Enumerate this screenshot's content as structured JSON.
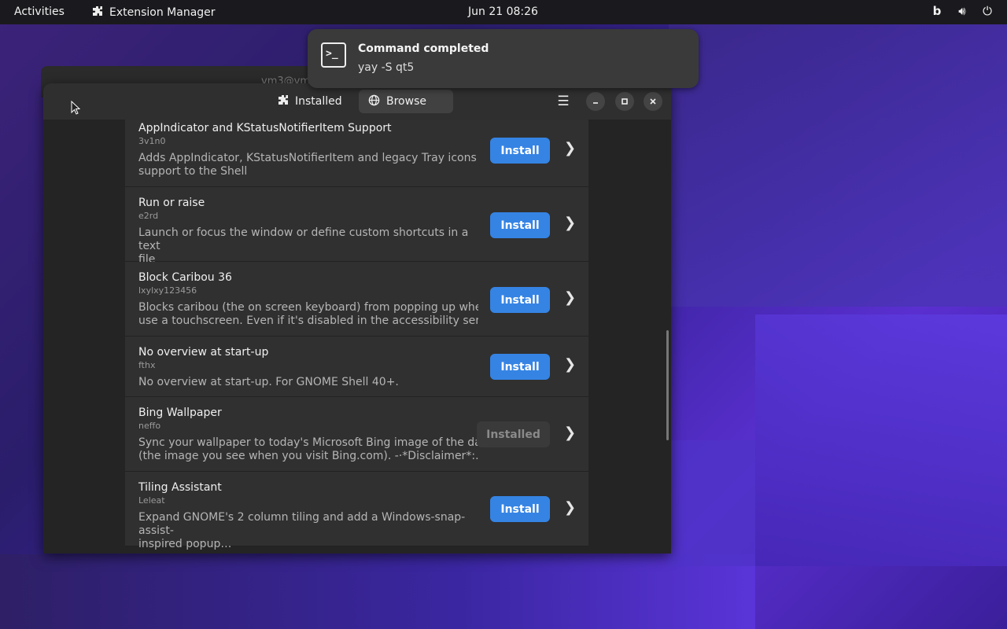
{
  "topbar": {
    "activities": "Activities",
    "app_name": "Extension Manager",
    "clock": "Jun 21  08:26",
    "icons": [
      "bing-icon",
      "volume-icon",
      "power-icon"
    ]
  },
  "background_window": {
    "title_partial": "vm3@vm"
  },
  "notification": {
    "title": "Command completed",
    "body": "yay -S qt5",
    "icon": "terminal-icon"
  },
  "window": {
    "tabs": [
      {
        "label": "Installed",
        "icon": "puzzle-icon",
        "active": false
      },
      {
        "label": "Browse",
        "icon": "globe-icon",
        "active": true
      }
    ],
    "controls": [
      "menu",
      "minimize",
      "maximize",
      "close"
    ]
  },
  "extensions": [
    {
      "name": "AppIndicator and KStatusNotifierItem Support",
      "author": "3v1n0",
      "desc1": "Adds AppIndicator, KStatusNotifierItem and legacy Tray icons",
      "desc2": "support to the Shell",
      "action": "Install"
    },
    {
      "name": "Run or raise",
      "author": "e2rd",
      "desc1": "Launch or focus the window or define custom shortcuts in a text",
      "desc2": "file",
      "action": "Install"
    },
    {
      "name": "Block Caribou 36",
      "author": "lxylxy123456",
      "desc1": "Blocks caribou (the on screen keyboard) from popping up when you",
      "desc2": "use a touchscreen. Even if it's disabled in the accessibility servic…",
      "action": "Install"
    },
    {
      "name": "No overview at start-up",
      "author": "fthx",
      "desc1": "No overview at start-up. For GNOME Shell 40+.",
      "desc2": "",
      "action": "Install"
    },
    {
      "name": "Bing Wallpaper",
      "author": "neffo",
      "desc1": "Sync your wallpaper to today's Microsoft Bing image of the day",
      "desc2": "(the image you see when you visit Bing.com). -·*Disclaimer*:…",
      "action": "Installed"
    },
    {
      "name": "Tiling Assistant",
      "author": "Leleat",
      "desc1": "Expand GNOME's 2 column tiling and add a Windows-snap-assist-",
      "desc2": "inspired popup…",
      "action": "Install"
    }
  ],
  "colors": {
    "accent": "#3584e4",
    "window_bg": "#242424",
    "row_bg": "#303030"
  }
}
